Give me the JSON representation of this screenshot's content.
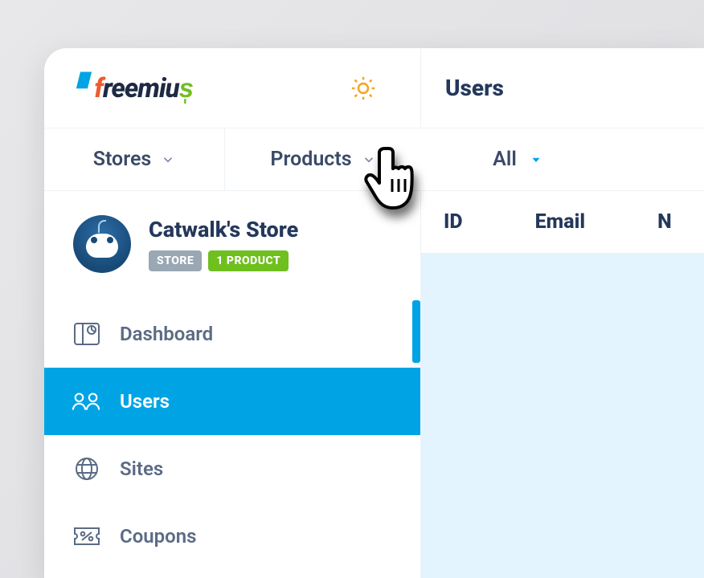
{
  "brand": {
    "name": "freemius"
  },
  "header": {
    "page_title": "Users",
    "theme_icon": "sun-icon"
  },
  "selectors": {
    "stores_label": "Stores",
    "products_label": "Products",
    "filter_label": "All"
  },
  "store": {
    "name": "Catwalk's Store",
    "badge_store": "STORE",
    "badge_product": "1 PRODUCT"
  },
  "nav": {
    "items": [
      {
        "key": "dashboard",
        "label": "Dashboard",
        "active": false
      },
      {
        "key": "users",
        "label": "Users",
        "active": true
      },
      {
        "key": "sites",
        "label": "Sites",
        "active": false
      },
      {
        "key": "coupons",
        "label": "Coupons",
        "active": false
      }
    ]
  },
  "table": {
    "columns": [
      {
        "key": "id",
        "label": "ID"
      },
      {
        "key": "email",
        "label": "Email"
      },
      {
        "key": "name",
        "label": "N"
      }
    ]
  },
  "colors": {
    "accent": "#00a4e4",
    "text_dark": "#24385b",
    "badge_green": "#6fbf1f",
    "badge_gray": "#9aa7b4"
  }
}
